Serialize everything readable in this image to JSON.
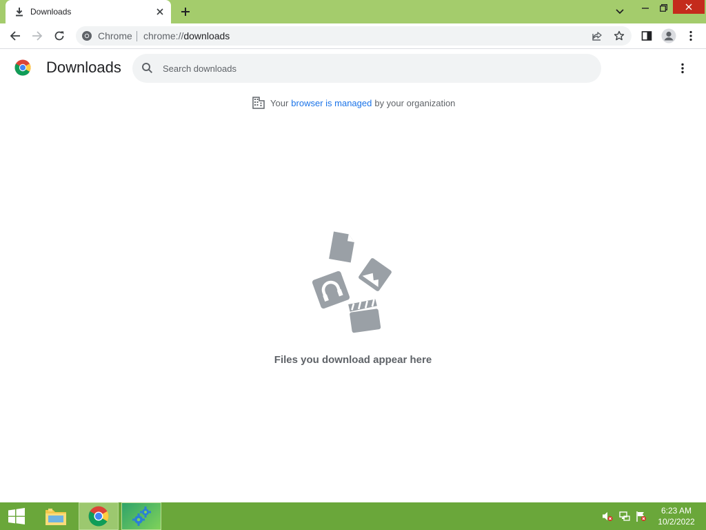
{
  "browser": {
    "tab_title": "Downloads",
    "omnibox_chip": "Chrome",
    "url_scheme": "chrome://",
    "url_path": "downloads"
  },
  "page": {
    "title": "Downloads",
    "search_placeholder": "Search downloads",
    "managed_prefix": "Your",
    "managed_link": "browser is managed",
    "managed_suffix": "by your organization",
    "empty_message": "Files you download appear here"
  },
  "taskbar": {
    "time": "6:23 AM",
    "date": "10/2/2022"
  },
  "colors": {
    "titlebar": "#a4cc6c",
    "taskbar": "#6aa73a",
    "link": "#1a73e8",
    "illustration": "#9aa0a6"
  }
}
